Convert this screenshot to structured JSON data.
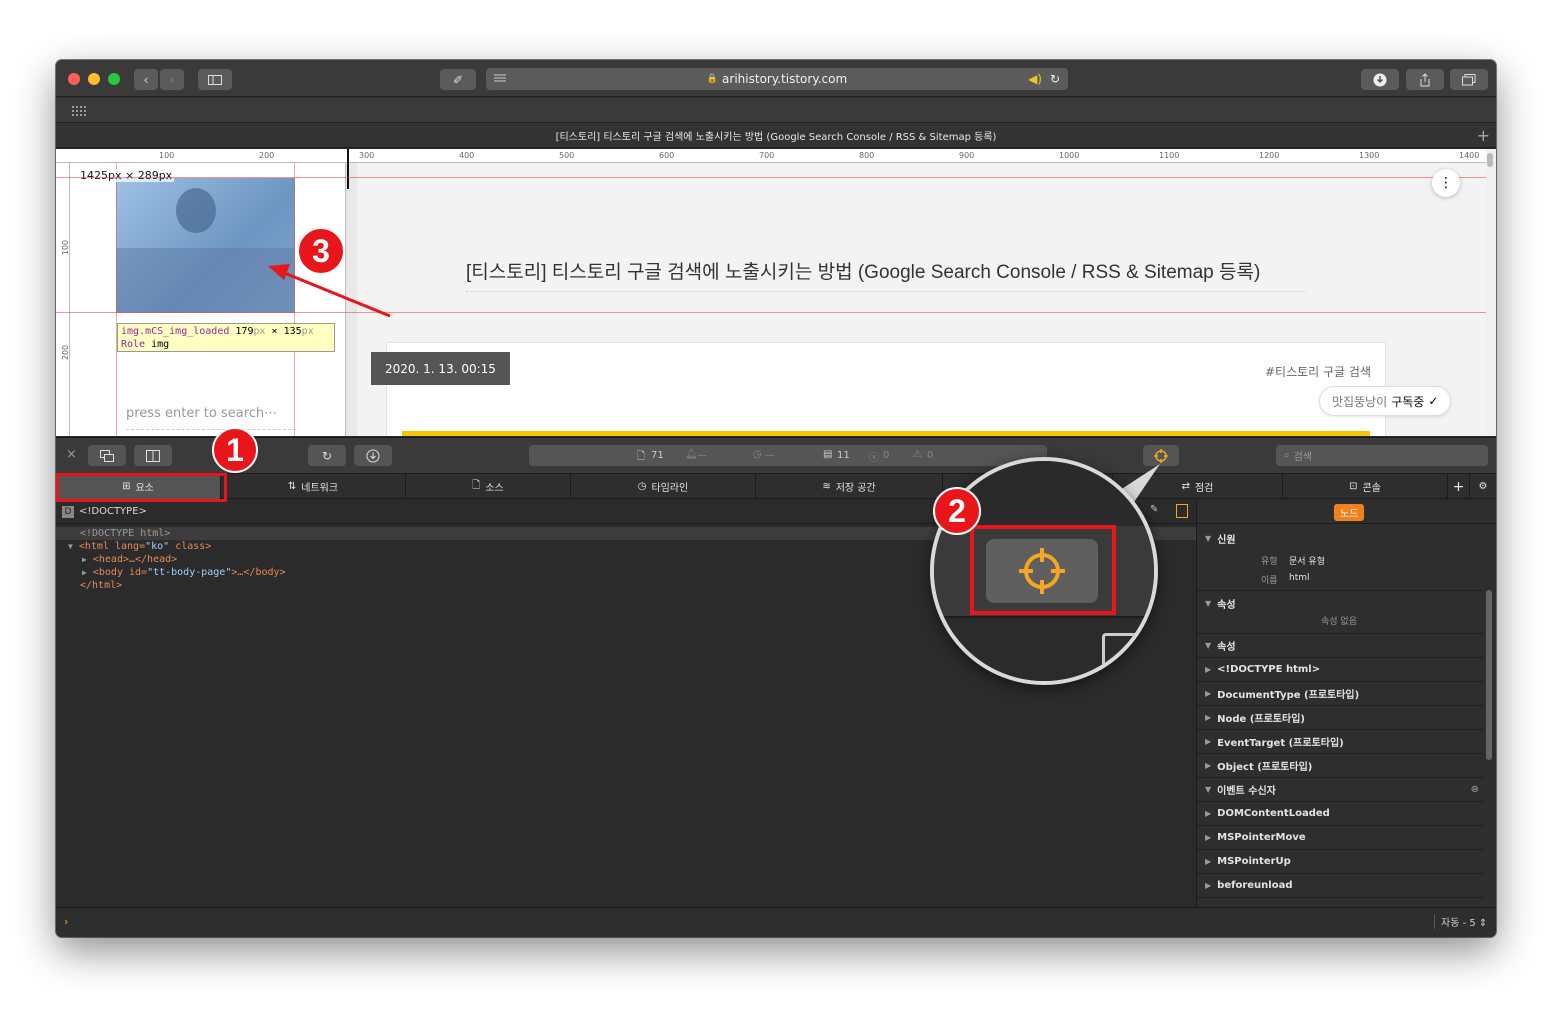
{
  "browser": {
    "url": "arihistory.tistory.com",
    "tab_title": "[티스토리] 티스토리 구글 검색에 노출시키는 방법 (Google Search Console / RSS & Sitemap 등록)"
  },
  "page": {
    "dimension_label": "1425px × 289px",
    "post_title": "[티스토리] 티스토리 구글 검색에 노출시키는 방법 (Google Search Console / RSS & Sitemap 등록)",
    "date_tag": "2020. 1. 13. 00:15",
    "hashtag": "#티스토리 구글 검색",
    "subscribe_name": "맛집뚱낭이",
    "subscribe_status": "구독중",
    "search_placeholder": "press enter to search⋯",
    "ruler_labels": [
      "100",
      "200",
      "300",
      "400",
      "500",
      "600",
      "700",
      "800",
      "900",
      "1000",
      "1100",
      "1200",
      "1300",
      "1400"
    ],
    "vruler_labels": [
      "100",
      "200"
    ]
  },
  "tooltip": {
    "selector": "img.mCS_img_loaded",
    "width": "179",
    "height": "135",
    "px": "px",
    "times": "×",
    "role_label": "Role",
    "role_value": "img"
  },
  "devtools": {
    "resources_count": "71",
    "bell": "—",
    "time": "—",
    "logs_count": "11",
    "errors_count": "0",
    "warnings_count": "0",
    "search_placeholder": "검색",
    "tabs": [
      "요소",
      "네트워크",
      "소스",
      "타임라인",
      "저장 공간",
      "점검",
      "콘솔"
    ],
    "breadcrumb": "<!DOCTYPE>",
    "dom": {
      "line1": "<!DOCTYPE html>",
      "html_open": "<html",
      "lang_attr": " lang=",
      "lang_val": "\"ko\"",
      "class_attr": " class",
      "close": ">",
      "head": "<head>…</head>",
      "body_open": "<body",
      "id_attr": " id=",
      "id_val": "\"tt-body-page\"",
      "body_rest": ">…</body>",
      "html_close": "</html>"
    },
    "sidebar": {
      "node_tab": "노드",
      "identity": "신원",
      "type_label": "유형",
      "type_value": "문서 유형",
      "name_label": "이름",
      "name_value": "html",
      "attributes": "속성",
      "no_attributes": "속성 없음",
      "properties": "속성",
      "items": [
        "<!DOCTYPE html>",
        "DocumentType (프로토타입)",
        "Node (프로토타입)",
        "EventTarget (프로토타입)",
        "Object (프로토타입)"
      ],
      "event_listeners": "이벤트 수신자",
      "events": [
        "DOMContentLoaded",
        "MSPointerMove",
        "MSPointerUp",
        "beforeunload"
      ]
    },
    "footer_right": "자동 - 5"
  },
  "annotations": {
    "badge1": "1",
    "badge2": "2",
    "badge3": "3"
  },
  "colors": {
    "accent_orange": "#f5a623",
    "annotation_red": "#e8151b",
    "devtools_bg": "#2b2b2b",
    "node_badge": "#f0821e"
  }
}
